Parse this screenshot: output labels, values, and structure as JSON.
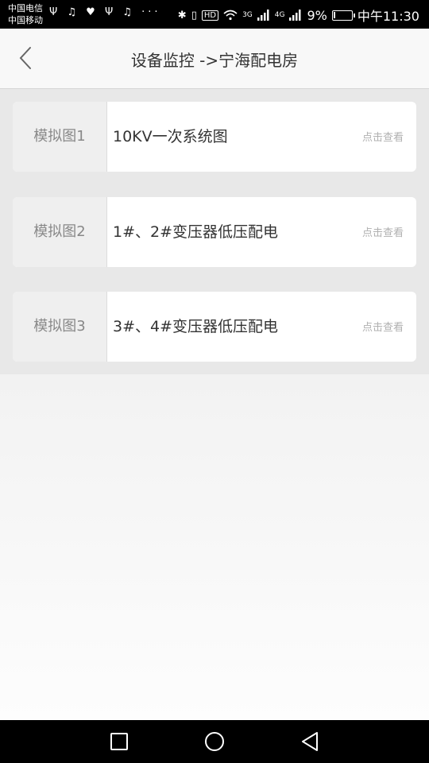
{
  "status_bar": {
    "carrier_1": "中国电信",
    "carrier_2": "中国移动",
    "left_icons": "Ψ ♫ ♥ Ψ ♫ ···",
    "hd": "HD",
    "net_3g": "3G",
    "net_4g": "4G",
    "battery_percent": "9%",
    "battery_level": 0.09,
    "time": "中午11:30"
  },
  "nav": {
    "title": "设备监控 ->宁海配电房"
  },
  "cards": [
    {
      "label": "模拟图1",
      "title": "10KV一次系统图",
      "action": "点击查看"
    },
    {
      "label": "模拟图2",
      "title": "1#、2#变压器低压配电",
      "action": "点击查看"
    },
    {
      "label": "模拟图3",
      "title": "3#、4#变压器低压配电",
      "action": "点击查看"
    }
  ],
  "colors": {
    "page_bg": "#f6f6f6",
    "list_bg": "#e8e8e8",
    "card_bg": "#ffffff",
    "label_bg": "#efefef",
    "action_text": "#b0b0b0"
  }
}
